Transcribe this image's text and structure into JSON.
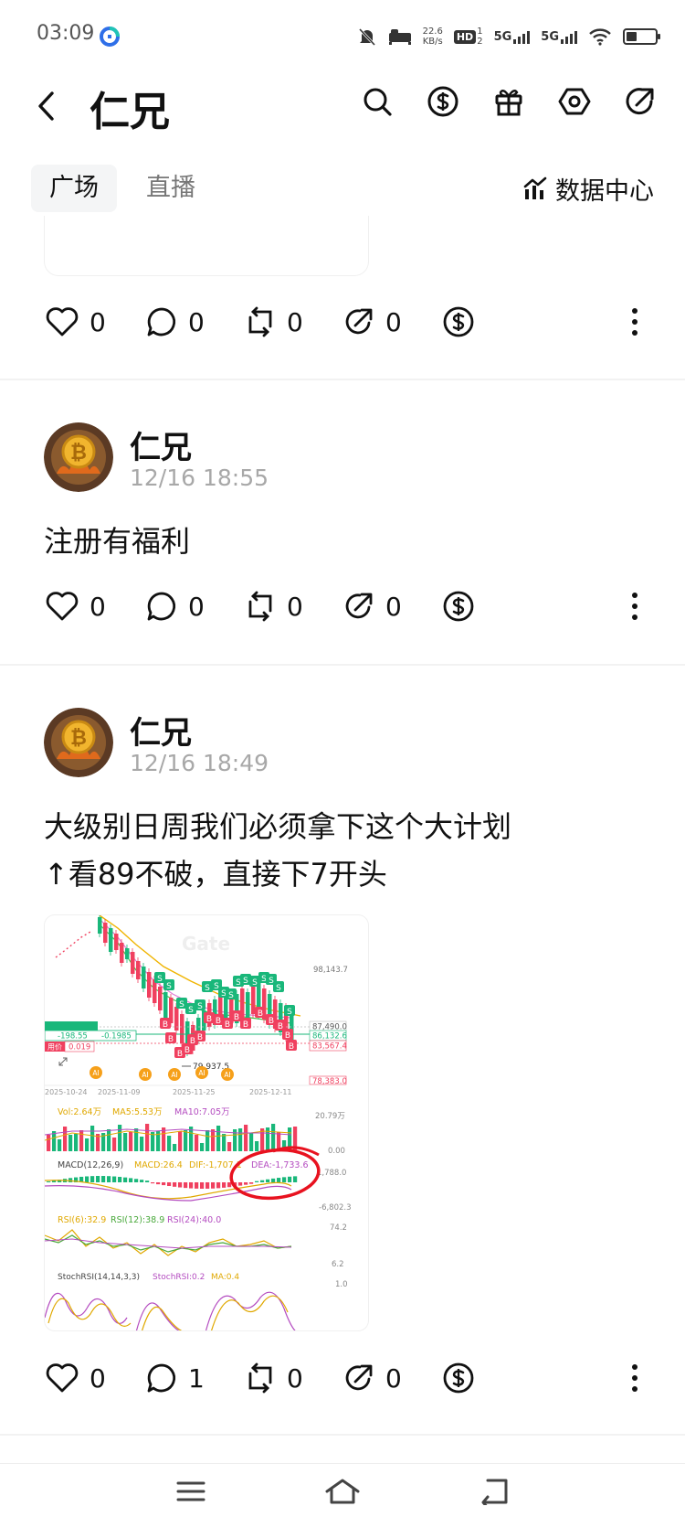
{
  "status_bar": {
    "time": "03:09",
    "net_speed_value": "22.6",
    "net_speed_unit": "KB/s",
    "hd_label": "HD",
    "sim1": "1",
    "sim2": "2",
    "net1": "5G",
    "net2": "5G",
    "battery_level": 0.35
  },
  "header": {
    "title": "仁兄"
  },
  "tabs": [
    {
      "label": "广场",
      "active": true
    },
    {
      "label": "直播",
      "active": false
    }
  ],
  "data_center_label": "数据中心",
  "posts": [
    {
      "likes": "0",
      "comments": "0",
      "reposts": "0",
      "shares": "0"
    },
    {
      "author": "仁兄",
      "time": "12/16 18:55",
      "text": "注册有福利",
      "likes": "0",
      "comments": "0",
      "reposts": "0",
      "shares": "0"
    },
    {
      "author": "仁兄",
      "time": "12/16 18:49",
      "text_line1": "大级别日周我们必须拿下这个大计划",
      "text_line2": "↑看89不破，直接下7开头",
      "likes": "0",
      "comments": "1",
      "reposts": "0",
      "shares": "0"
    }
  ],
  "chart_image": {
    "watermark": "Gate",
    "price_labels": [
      "98,143.7",
      "87,490.0",
      "86,132.6",
      "83,567.4",
      "78,383.0"
    ],
    "low_label": "79,937.5",
    "dates": [
      "2025-10-24",
      "2025-11-09",
      "2025-11-25",
      "2025-12-11"
    ],
    "vol_line": "Vol:2.64万",
    "ma5_line": "MA5:5.53万",
    "ma10_line": "MA10:7.05万",
    "vol_max": "20.79万",
    "vol_zero": "0.00",
    "macd_line": "MACD(12,26,9)",
    "macd_value": "MACD:26.4",
    "dif_value": "DIF:-1,707.1",
    "dea_value": "DEA:-1,733.6",
    "macd_top": "1,788.0",
    "macd_bottom": "-6,802.3",
    "rsi6": "RSI(6):32.9",
    "rsi12": "RSI(12):38.9",
    "rsi24": "RSI(24):40.0",
    "rsi_top": "74.2",
    "rsi_bottom": "6.2",
    "stoch_line": "StochRSI(14,14,3,3)",
    "stoch_value": "StochRSI:0.2",
    "stoch_ma": "MA:0.4",
    "stoch_top": "1.0",
    "left_label1": "-198.55",
    "left_label2": "-0.1985",
    "left_label3": "0.019",
    "left_tag": "用价",
    "markers": [
      "S",
      "B",
      "AI"
    ]
  },
  "colors": {
    "up": "#19b77a",
    "down": "#f0405f",
    "annotation": "#e8121f",
    "muted": "#a8a8a8"
  }
}
